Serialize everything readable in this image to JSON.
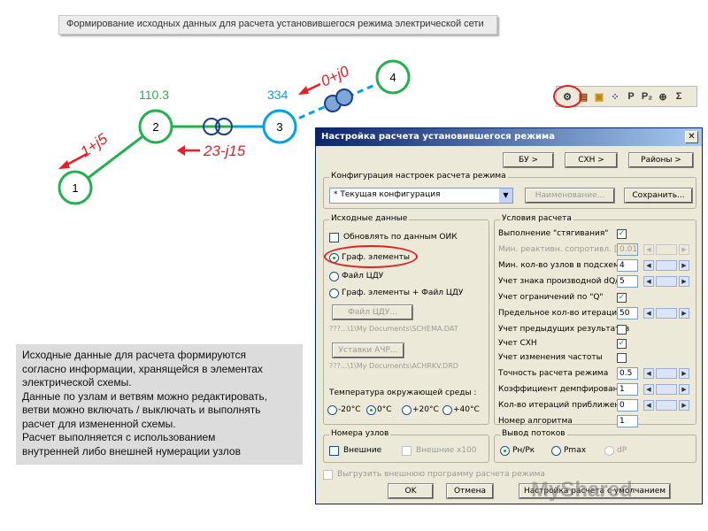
{
  "slide_title": "Формирование исходных данных для расчета установившегося режима электрической сети",
  "diagram": {
    "nodes": [
      {
        "id": "1",
        "label": "1",
        "color": "#22b14c"
      },
      {
        "id": "2",
        "label": "2",
        "color": "#22b14c"
      },
      {
        "id": "3",
        "label": "3",
        "color": "#00a2e8"
      },
      {
        "id": "4",
        "label": "4",
        "color": "#22b14c"
      }
    ],
    "voltage_2": "110.3",
    "voltage_3": "334",
    "load_1": "1+j5",
    "load_2_3": "23-j15",
    "load_4": "0+j0",
    "colors": {
      "green": "#22b14c",
      "blue": "#00a2e8",
      "red": "#ed1c24"
    }
  },
  "note_lines": [
    "Исходные данные для расчета формируются",
    "согласно информации, хранящейся в элементах",
    "электрической схемы.",
    "Данные по узлам и ветвям можно редактировать,",
    "ветви можно включать / выключать и выполнять",
    "расчет для измененной схемы.",
    "Расчет выполняется с использованием",
    "внутренней либо внешней нумерации узлов"
  ],
  "toolbar": {
    "icons": [
      "calc-icon",
      "table-icon",
      "edit-icon",
      "nodes-icon",
      "p-icon",
      "p2-icon",
      "zoom-icon",
      "sum-icon"
    ],
    "p_label": "P",
    "p2_label": "P₂",
    "sum_label": "Σ"
  },
  "dialog": {
    "title": "Настройка расчета установившегося режима",
    "close": "✕",
    "top_buttons": {
      "bu": "БУ >",
      "skhn": "СХН >",
      "raiony": "Районы >"
    },
    "config_group": "Конфигурация настроек расчета режима",
    "config_value": "*    Текущая конфигурация",
    "naimenovanie": "Наименование...",
    "save": "Сохранить...",
    "source_group": "Исходные данные",
    "update_oik": "Обновлять по данным ОИК",
    "radio_graf": "Граф. элементы",
    "radio_file": "Файл ЦДУ",
    "radio_both": "Граф. элементы + Файл ЦДУ",
    "file_button": "Файл ЦДУ...",
    "file_path": "???...\\1\\My Documents\\SCHEMA.DAT",
    "achr_button": "Уставки АЧР...",
    "achr_path": "???...\\1\\My Documents\\ACHRKV.DRD",
    "temp_label": "Температура окружающей среды :",
    "temps": [
      "-20°C",
      "0°C",
      "+20°C",
      "+40°C"
    ],
    "cond_group": "Условия расчета",
    "conditions": [
      {
        "label": "Выполнение \"стягивания\"",
        "type": "check",
        "checked": "✓"
      },
      {
        "label": "Мин. реактивн. сопротивл. [Ом]",
        "type": "field",
        "value": "0.01"
      },
      {
        "label": "Мин. кол-во узлов в подсхемах",
        "type": "field",
        "value": "4"
      },
      {
        "label": "Учет знака производной dQ/dU",
        "type": "field",
        "value": "5"
      },
      {
        "label": "Учет ограничений по \"Q\"",
        "type": "check",
        "checked": "✓"
      },
      {
        "label": "Предельное кол-во итераций",
        "type": "field",
        "value": "50"
      },
      {
        "label": "Учет предыдущих результатов",
        "type": "check",
        "checked": ""
      },
      {
        "label": "Учет СХН",
        "type": "check",
        "checked": "✓"
      },
      {
        "label": "Учет изменения частоты",
        "type": "check",
        "checked": ""
      },
      {
        "label": "Точность расчета режима",
        "type": "field",
        "value": "0.5"
      },
      {
        "label": "Коэффициент демпфирования",
        "type": "field",
        "value": "1"
      },
      {
        "label": "Кол-во итераций приближения",
        "type": "field",
        "value": "0"
      },
      {
        "label": "Номер алгоритма",
        "type": "field",
        "value": "1"
      }
    ],
    "nodes_group": "Номера узлов",
    "ext": "Внешние",
    "ext100": "Внешние х100",
    "flow_group": "Вывод потоков",
    "flow_pk": "Рн/Рк",
    "flow_pmax": "Pmax",
    "flow_dp": "dP",
    "unload": "Выгрузить внешнюю программу расчета режима",
    "ok": "OK",
    "cancel": "Отмена",
    "save_default": "Настройка расчета с умолчанием"
  },
  "watermark": "MyShared"
}
